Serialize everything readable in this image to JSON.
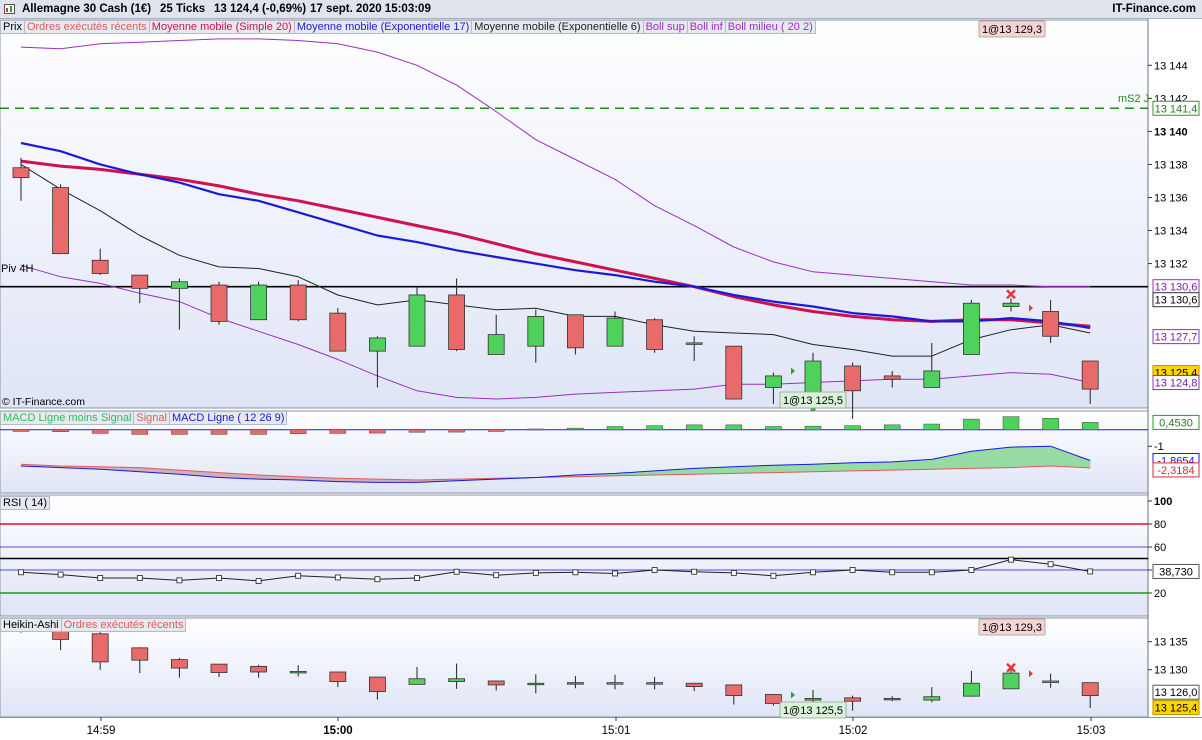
{
  "header": {
    "title": "Allemagne 30 Cash (1€)",
    "ticks": "25 Ticks",
    "price": "13 124,4 (-0,69%)",
    "datetime": "17 sept. 2020 15:03:09",
    "brand": "IT-Finance.com"
  },
  "price_panel": {
    "legend": [
      {
        "label": "Prix",
        "color": "#000000"
      },
      {
        "label": "Ordres exécutés récents",
        "color": "#e05a5a"
      },
      {
        "label": "Moyenne mobile (Simple 20)",
        "color": "#d0104f"
      },
      {
        "label": "Moyenne mobile (Exponentielle 17)",
        "color": "#1a1ad8"
      },
      {
        "label": "Moyenne mobile (Exponentielle 6)",
        "color": "#222222"
      },
      {
        "label": "Boll sup",
        "color": "#9a2ec4"
      },
      {
        "label": "Boll inf",
        "color": "#9a2ec4"
      },
      {
        "label": "Boll milieu ( 20 2)",
        "color": "#9a2ec4"
      }
    ],
    "piv_label": "Piv 4H",
    "ms2_label": "mS2 J",
    "copyright": "© IT-Finance.com",
    "order_top": "1@13 129,3",
    "order_bottom": "1@13 125,5",
    "axis_ticks": [
      "13 144",
      "13 142",
      "13 140",
      "13 138",
      "13 136",
      "13 134",
      "13 132"
    ],
    "axis_tags": [
      {
        "value": 13141.4,
        "label": "13 141,4",
        "style": "green"
      },
      {
        "value": 13130.6,
        "label": "13 130,6",
        "style": "purple"
      },
      {
        "value": 13130.6,
        "label": "13 130,6",
        "style": "black"
      },
      {
        "value": 13127.7,
        "label": "13 127,7",
        "style": "purple"
      },
      {
        "value": 13125.4,
        "label": "13 125,4",
        "style": "yellow"
      },
      {
        "value": 13124.8,
        "label": "13 124,8",
        "style": "purple"
      }
    ]
  },
  "macd_panel": {
    "legend": [
      {
        "label": "MACD Ligne moins Signal",
        "color": "#33bb55"
      },
      {
        "label": "Signal",
        "color": "#e05a5a"
      },
      {
        "label": "MACD Ligne ( 12 26 9)",
        "color": "#1a1ad8"
      }
    ],
    "axis_ticks": [
      "-1"
    ],
    "tags": [
      {
        "label": "0,4530",
        "style": "green"
      },
      {
        "label": "-1,8654",
        "style": "blue"
      },
      {
        "label": "-2,3184",
        "style": "red"
      }
    ]
  },
  "rsi_panel": {
    "legend": [
      {
        "label": "RSI ( 14)",
        "color": "#000000"
      }
    ],
    "axis_ticks": [
      "100",
      "80",
      "60",
      "40",
      "20"
    ],
    "tag": "38,730"
  },
  "ha_panel": {
    "legend": [
      {
        "label": "Heikin-Ashi",
        "color": "#000000"
      },
      {
        "label": "Ordres exécutés récents",
        "color": "#e05a5a"
      }
    ],
    "order_top": "1@13 129,3",
    "order_bottom": "1@13 125,5",
    "axis_ticks": [
      "13 135",
      "13 130"
    ],
    "tags": [
      {
        "label": "13 126,0",
        "style": "white"
      },
      {
        "label": "13 125,4",
        "style": "yellow"
      }
    ]
  },
  "time_axis": [
    "14:59",
    "15:00",
    "15:01",
    "15:02",
    "15:03"
  ],
  "chart_data": [
    {
      "type": "candlestick",
      "title": "Allemagne 30 Cash (1€)",
      "ylim": [
        13123.5,
        13146.5
      ],
      "candles": [
        {
          "o": 13137.8,
          "h": 13138.4,
          "l": 13135.8,
          "c": 13137.2
        },
        {
          "o": 13136.6,
          "h": 13136.8,
          "l": 13132.6,
          "c": 13132.6
        },
        {
          "o": 13132.2,
          "h": 13132.9,
          "l": 13131.3,
          "c": 13131.4
        },
        {
          "o": 13131.3,
          "h": 13131.3,
          "l": 13129.6,
          "c": 13130.5
        },
        {
          "o": 13130.5,
          "h": 13131.1,
          "l": 13128.0,
          "c": 13130.9
        },
        {
          "o": 13130.7,
          "h": 13130.9,
          "l": 13128.3,
          "c": 13128.5
        },
        {
          "o": 13128.6,
          "h": 13130.9,
          "l": 13128.6,
          "c": 13130.7
        },
        {
          "o": 13130.7,
          "h": 13131.0,
          "l": 13128.5,
          "c": 13128.6
        },
        {
          "o": 13129.0,
          "h": 13129.3,
          "l": 13126.7,
          "c": 13126.7
        },
        {
          "o": 13126.7,
          "h": 13127.6,
          "l": 13124.5,
          "c": 13127.5
        },
        {
          "o": 13127.0,
          "h": 13130.6,
          "l": 13127.0,
          "c": 13130.1
        },
        {
          "o": 13130.1,
          "h": 13131.1,
          "l": 13126.7,
          "c": 13126.8
        },
        {
          "o": 13126.5,
          "h": 13128.9,
          "l": 13126.5,
          "c": 13127.7
        },
        {
          "o": 13127.0,
          "h": 13129.2,
          "l": 13126.0,
          "c": 13128.8
        },
        {
          "o": 13128.9,
          "h": 13128.9,
          "l": 13126.5,
          "c": 13126.9
        },
        {
          "o": 13127.0,
          "h": 13129.1,
          "l": 13127.0,
          "c": 13128.7
        },
        {
          "o": 13128.6,
          "h": 13128.7,
          "l": 13126.6,
          "c": 13126.8
        },
        {
          "o": 13127.2,
          "h": 13127.6,
          "l": 13126.1,
          "c": 13127.2
        },
        {
          "o": 13127.0,
          "h": 13127.0,
          "l": 13123.8,
          "c": 13123.8
        },
        {
          "o": 13124.5,
          "h": 13125.4,
          "l": 13123.5,
          "c": 13125.2
        },
        {
          "o": 13123.9,
          "h": 13126.6,
          "l": 13123.9,
          "c": 13126.1
        },
        {
          "o": 13125.8,
          "h": 13126.0,
          "l": 13122.6,
          "c": 13124.3
        },
        {
          "o": 13125.2,
          "h": 13125.5,
          "l": 13124.5,
          "c": 13125.0
        },
        {
          "o": 13124.5,
          "h": 13127.2,
          "l": 13124.5,
          "c": 13125.5
        },
        {
          "o": 13126.5,
          "h": 13129.8,
          "l": 13126.5,
          "c": 13129.6
        },
        {
          "o": 13129.4,
          "h": 13129.9,
          "l": 13129.1,
          "c": 13129.6
        },
        {
          "o": 13129.1,
          "h": 13129.8,
          "l": 13127.2,
          "c": 13127.6
        },
        {
          "o": 13126.1,
          "h": 13126.1,
          "l": 13123.5,
          "c": 13124.4
        }
      ],
      "sma20": [
        13138.2,
        13137.9,
        13137.7,
        13137.4,
        13137.1,
        13136.7,
        13136.2,
        13135.8,
        13135.3,
        13134.8,
        13134.3,
        13133.8,
        13133.2,
        13132.6,
        13132.1,
        13131.6,
        13131.1,
        13130.6,
        13130.0,
        13129.5,
        13129.1,
        13128.8,
        13128.6,
        13128.5,
        13128.6,
        13128.6,
        13128.4,
        13128.2
      ],
      "ema17": [
        13139.3,
        13138.8,
        13138.0,
        13137.4,
        13136.9,
        13136.2,
        13135.8,
        13135.1,
        13134.4,
        13133.7,
        13133.3,
        13132.8,
        13132.4,
        13132.0,
        13131.6,
        13131.3,
        13130.9,
        13130.6,
        13130.1,
        13129.7,
        13129.4,
        13129.0,
        13128.8,
        13128.5,
        13128.5,
        13128.7,
        13128.5,
        13128.1
      ],
      "ema6": [
        13138.0,
        13136.5,
        13135.2,
        13133.7,
        13132.5,
        13131.8,
        13131.7,
        13131.2,
        13130.1,
        13129.5,
        13129.8,
        13129.5,
        13129.2,
        13129.3,
        13128.8,
        13128.8,
        13128.3,
        13127.9,
        13127.8,
        13127.7,
        13127.1,
        13126.8,
        13126.4,
        13126.4,
        13127.4,
        13128.0,
        13128.3,
        13127.8
      ],
      "boll_sup": [
        13145.1,
        13145.0,
        13145.3,
        13145.4,
        13145.5,
        13145.6,
        13145.6,
        13145.5,
        13145.3,
        13144.8,
        13144.0,
        13142.8,
        13141.2,
        13139.5,
        13138.3,
        13137.1,
        13135.5,
        13134.3,
        13133.0,
        13132.1,
        13131.5,
        13131.3,
        13131.1,
        13130.9,
        13130.7,
        13130.7,
        13130.6,
        13130.6
      ],
      "boll_inf": [
        13131.9,
        13131.2,
        13130.8,
        13130.2,
        13129.7,
        13128.7,
        13127.9,
        13127.1,
        13126.2,
        13125.2,
        13124.3,
        13123.9,
        13123.8,
        13123.9,
        13124.1,
        13124.2,
        13124.3,
        13124.4,
        13124.7,
        13124.7,
        13124.8,
        13124.9,
        13125.0,
        13125.0,
        13125.2,
        13125.4,
        13125.3,
        13124.8
      ],
      "levels": {
        "pivot_4h": 13130.6,
        "ms2_j": 13141.4
      },
      "orders": [
        {
          "side": "sell",
          "price": 13129.3,
          "candle_index": 25
        },
        {
          "side": "buy",
          "price": 13125.5,
          "candle_index": 20
        }
      ]
    },
    {
      "type": "bar",
      "title": "MACD Ligne ( 12 26 9)",
      "ylim": [
        -3.6,
        0.9
      ],
      "histogram": [
        -0.1,
        -0.12,
        -0.22,
        -0.28,
        -0.28,
        -0.28,
        -0.28,
        -0.24,
        -0.22,
        -0.2,
        -0.15,
        -0.14,
        -0.1,
        0.05,
        0.1,
        0.2,
        0.25,
        0.3,
        0.3,
        0.2,
        0.22,
        0.25,
        0.3,
        0.35,
        0.65,
        0.8,
        0.7,
        0.453
      ],
      "macd": [
        -2.2,
        -2.3,
        -2.4,
        -2.55,
        -2.7,
        -2.9,
        -3.0,
        -3.05,
        -3.15,
        -3.2,
        -3.2,
        -3.1,
        -3.0,
        -2.9,
        -2.75,
        -2.65,
        -2.5,
        -2.35,
        -2.25,
        -2.15,
        -2.1,
        -2.0,
        -1.95,
        -1.8,
        -1.3,
        -1.05,
        -1.0,
        -1.8654
      ],
      "signal": [
        -2.1,
        -2.2,
        -2.25,
        -2.3,
        -2.45,
        -2.6,
        -2.75,
        -2.85,
        -2.95,
        -3.0,
        -3.05,
        -3.0,
        -2.95,
        -2.9,
        -2.85,
        -2.8,
        -2.75,
        -2.7,
        -2.65,
        -2.6,
        -2.55,
        -2.5,
        -2.45,
        -2.4,
        -2.35,
        -2.3,
        -2.2,
        -2.3184
      ]
    },
    {
      "type": "line",
      "title": "RSI ( 14)",
      "ylim": [
        0,
        100
      ],
      "levels": [
        80,
        60,
        40,
        20
      ],
      "values": [
        38.0,
        36.0,
        33.0,
        33.0,
        31.0,
        33.0,
        30.5,
        35.0,
        33.5,
        32.0,
        33.0,
        38.5,
        35.5,
        37.5,
        38.0,
        37.0,
        40.0,
        38.5,
        37.5,
        35.0,
        38.0,
        40.0,
        38.0,
        38.0,
        40.0,
        49.0,
        45.0,
        38.73
      ]
    },
    {
      "type": "candlestick",
      "title": "Heikin-Ashi",
      "ylim": [
        13122.3,
        13138.5
      ],
      "candles": [
        {
          "o": 13138.1,
          "h": 13138.4,
          "l": 13136.6,
          "c": 13137.1
        },
        {
          "o": 13137.6,
          "h": 13137.7,
          "l": 13133.5,
          "c": 13135.4
        },
        {
          "o": 13136.4,
          "h": 13136.7,
          "l": 13130.0,
          "c": 13131.4
        },
        {
          "o": 13133.9,
          "h": 13134.0,
          "l": 13129.4,
          "c": 13131.7
        },
        {
          "o": 13131.8,
          "h": 13132.1,
          "l": 13128.6,
          "c": 13130.3
        },
        {
          "o": 13131.0,
          "h": 13131.0,
          "l": 13128.7,
          "c": 13129.5
        },
        {
          "o": 13130.6,
          "h": 13130.9,
          "l": 13128.6,
          "c": 13129.6
        },
        {
          "o": 13129.7,
          "h": 13130.8,
          "l": 13128.8,
          "c": 13129.7
        },
        {
          "o": 13129.6,
          "h": 13129.7,
          "l": 13126.9,
          "c": 13127.9
        },
        {
          "o": 13128.7,
          "h": 13128.7,
          "l": 13124.7,
          "c": 13126.1
        },
        {
          "o": 13127.4,
          "h": 13130.5,
          "l": 13127.4,
          "c": 13128.4
        },
        {
          "o": 13127.9,
          "h": 13131.1,
          "l": 13126.6,
          "c": 13128.4
        },
        {
          "o": 13128.0,
          "h": 13128.0,
          "l": 13126.3,
          "c": 13127.3
        },
        {
          "o": 13127.6,
          "h": 13129.2,
          "l": 13125.8,
          "c": 13127.6
        },
        {
          "o": 13127.7,
          "h": 13128.9,
          "l": 13126.7,
          "c": 13127.6
        },
        {
          "o": 13127.7,
          "h": 13129.1,
          "l": 13126.5,
          "c": 13127.7
        },
        {
          "o": 13127.7,
          "h": 13128.7,
          "l": 13126.5,
          "c": 13127.7
        },
        {
          "o": 13127.6,
          "h": 13127.6,
          "l": 13126.2,
          "c": 13127.0
        },
        {
          "o": 13127.3,
          "h": 13127.3,
          "l": 13123.8,
          "c": 13125.4
        },
        {
          "o": 13125.6,
          "h": 13125.6,
          "l": 13123.6,
          "c": 13124.0
        },
        {
          "o": 13124.6,
          "h": 13126.4,
          "l": 13123.8,
          "c": 13124.9
        },
        {
          "o": 13125.0,
          "h": 13125.4,
          "l": 13122.7,
          "c": 13124.4
        },
        {
          "o": 13124.9,
          "h": 13125.3,
          "l": 13124.4,
          "c": 13124.8
        },
        {
          "o": 13124.6,
          "h": 13126.9,
          "l": 13124.2,
          "c": 13125.2
        },
        {
          "o": 13125.3,
          "h": 13129.8,
          "l": 13125.2,
          "c": 13127.6
        },
        {
          "o": 13126.6,
          "h": 13130.0,
          "l": 13126.6,
          "c": 13129.4
        },
        {
          "o": 13128.0,
          "h": 13129.3,
          "l": 13126.8,
          "c": 13128.0
        },
        {
          "o": 13127.7,
          "h": 13127.7,
          "l": 13123.2,
          "c": 13125.4
        }
      ],
      "orders": [
        {
          "side": "sell",
          "price": 13129.3,
          "candle_index": 25
        },
        {
          "side": "buy",
          "price": 13125.5,
          "candle_index": 20
        }
      ]
    }
  ]
}
